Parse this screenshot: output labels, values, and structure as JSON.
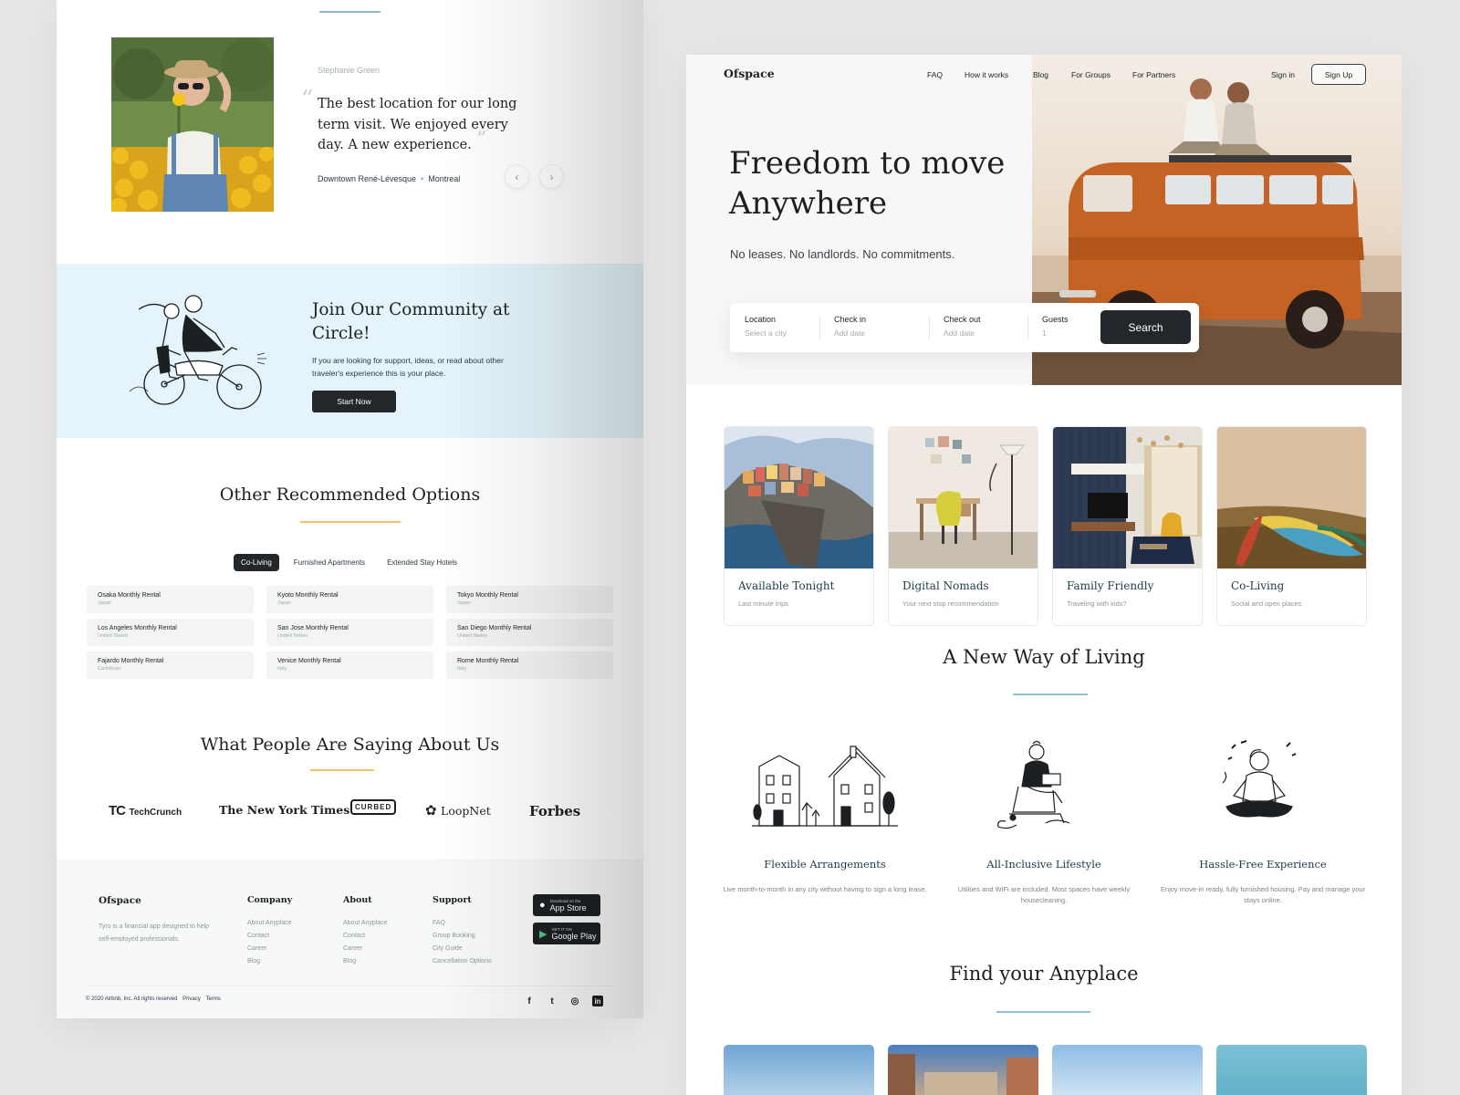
{
  "left": {
    "testimonial": {
      "author": "Stephanie Green",
      "open_quote": "“",
      "close_quote": "”",
      "quote": "The best location for our long term visit. We enjoyed every day. A new experience.",
      "place": "Downtown René-Lévesque",
      "city": "Montreal",
      "separator": "•",
      "prev_icon": "‹",
      "next_icon": "›"
    },
    "community": {
      "title": "Join Our Community at Circle!",
      "text": "If you are looking for support, ideas, or read about other traveler's experience this is your place.",
      "cta": "Start Now"
    },
    "recommended": {
      "title": "Other Recommended Options",
      "tabs": [
        {
          "label": "Co-Living"
        },
        {
          "label": "Furnished Apartments"
        },
        {
          "label": "Extended Stay Hotels"
        }
      ],
      "active_tab": "Co-Living",
      "items": [
        {
          "title": "Osaka Monthly Rental",
          "sub": "Japan"
        },
        {
          "title": "Kyoto Monthly Rental",
          "sub": "Japan"
        },
        {
          "title": "Tokyo Monthly Rental",
          "sub": "Japan"
        },
        {
          "title": "Los Angeles Monthly Rental",
          "sub": "United States"
        },
        {
          "title": "San Jose Monthly Rental",
          "sub": "United States"
        },
        {
          "title": "San Diego Monthly Rental",
          "sub": "United States"
        },
        {
          "title": "Fajardo Monthly Rental",
          "sub": "Caribbean"
        },
        {
          "title": "Venice Monthly Rental",
          "sub": "Italy"
        },
        {
          "title": "Rome Monthly Rental",
          "sub": "Italy"
        }
      ]
    },
    "press": {
      "title": "What People Are Saying About Us",
      "logos": {
        "techcrunch_mark": "TC",
        "techcrunch": "TechCrunch",
        "nyt": "The New York Times",
        "curbed": "CURBED",
        "loopnet": "LoopNet",
        "forbes": "Forbes"
      }
    },
    "footer": {
      "brand": "Ofspace",
      "desc": "Tyro is a financial app designed to help self-employed professionals.",
      "columns": [
        {
          "title": "Company",
          "links": [
            "About Anyplace",
            "Contact",
            "Career",
            "Blog"
          ]
        },
        {
          "title": "About",
          "links": [
            "About Anyplace",
            "Contact",
            "Career",
            "Blog"
          ]
        },
        {
          "title": "Support",
          "links": [
            "FAQ",
            "Group Booking",
            "City Guide",
            "Cancellation Options"
          ]
        }
      ],
      "app_store": {
        "small": "Download on the",
        "big": "App Store"
      },
      "google_play": {
        "small": "GET IT ON",
        "big": "Google Play"
      },
      "copyright": "© 2020 Airbnb, Inc. All rights reserved",
      "privacy": "Privacy",
      "terms": "Terms",
      "social": {
        "facebook": "f",
        "twitter": "t",
        "instagram": "◎",
        "linkedin": "in"
      }
    }
  },
  "right": {
    "brand": "Ofspace",
    "nav": {
      "faq": "FAQ",
      "how": "How it works",
      "blog": "Blog",
      "groups": "For Groups",
      "partners": "For Partners",
      "signin": "Sign in",
      "signup": "Sign Up"
    },
    "hero": {
      "title_line1": "Freedom to move",
      "title_line2": "Anywhere",
      "subtitle": "No leases. No landlords. No commitments."
    },
    "search": {
      "location_label": "Location",
      "location_value": "Select a city",
      "checkin_label": "Check in",
      "checkin_value": "Add date",
      "checkout_label": "Check out",
      "checkout_value": "Add date",
      "guests_label": "Guests",
      "guests_value": "1",
      "button": "Search"
    },
    "categories": [
      {
        "title": "Available Tonight",
        "sub": "Last minute trips"
      },
      {
        "title": "Digital Nomads",
        "sub": "Your next stop recommendation"
      },
      {
        "title": "Family Friendly",
        "sub": "Traveling with kids?"
      },
      {
        "title": "Co-Living",
        "sub": "Social and open places"
      }
    ],
    "way": {
      "title": "A New Way of Living",
      "features": [
        {
          "title": "Flexible Arrangements",
          "text": "Live month-to-month in any city without having to sign a long lease."
        },
        {
          "title": "All-Inclusive Lifestyle",
          "text": "Utilities and WiFi are included. Most spaces have weekly housecleaning."
        },
        {
          "title": "Hassle-Free Experience",
          "text": "Enjoy move-in ready, fully furnished housing. Pay and manage your stays online."
        }
      ]
    },
    "find": {
      "title": "Find your Anyplace"
    }
  }
}
